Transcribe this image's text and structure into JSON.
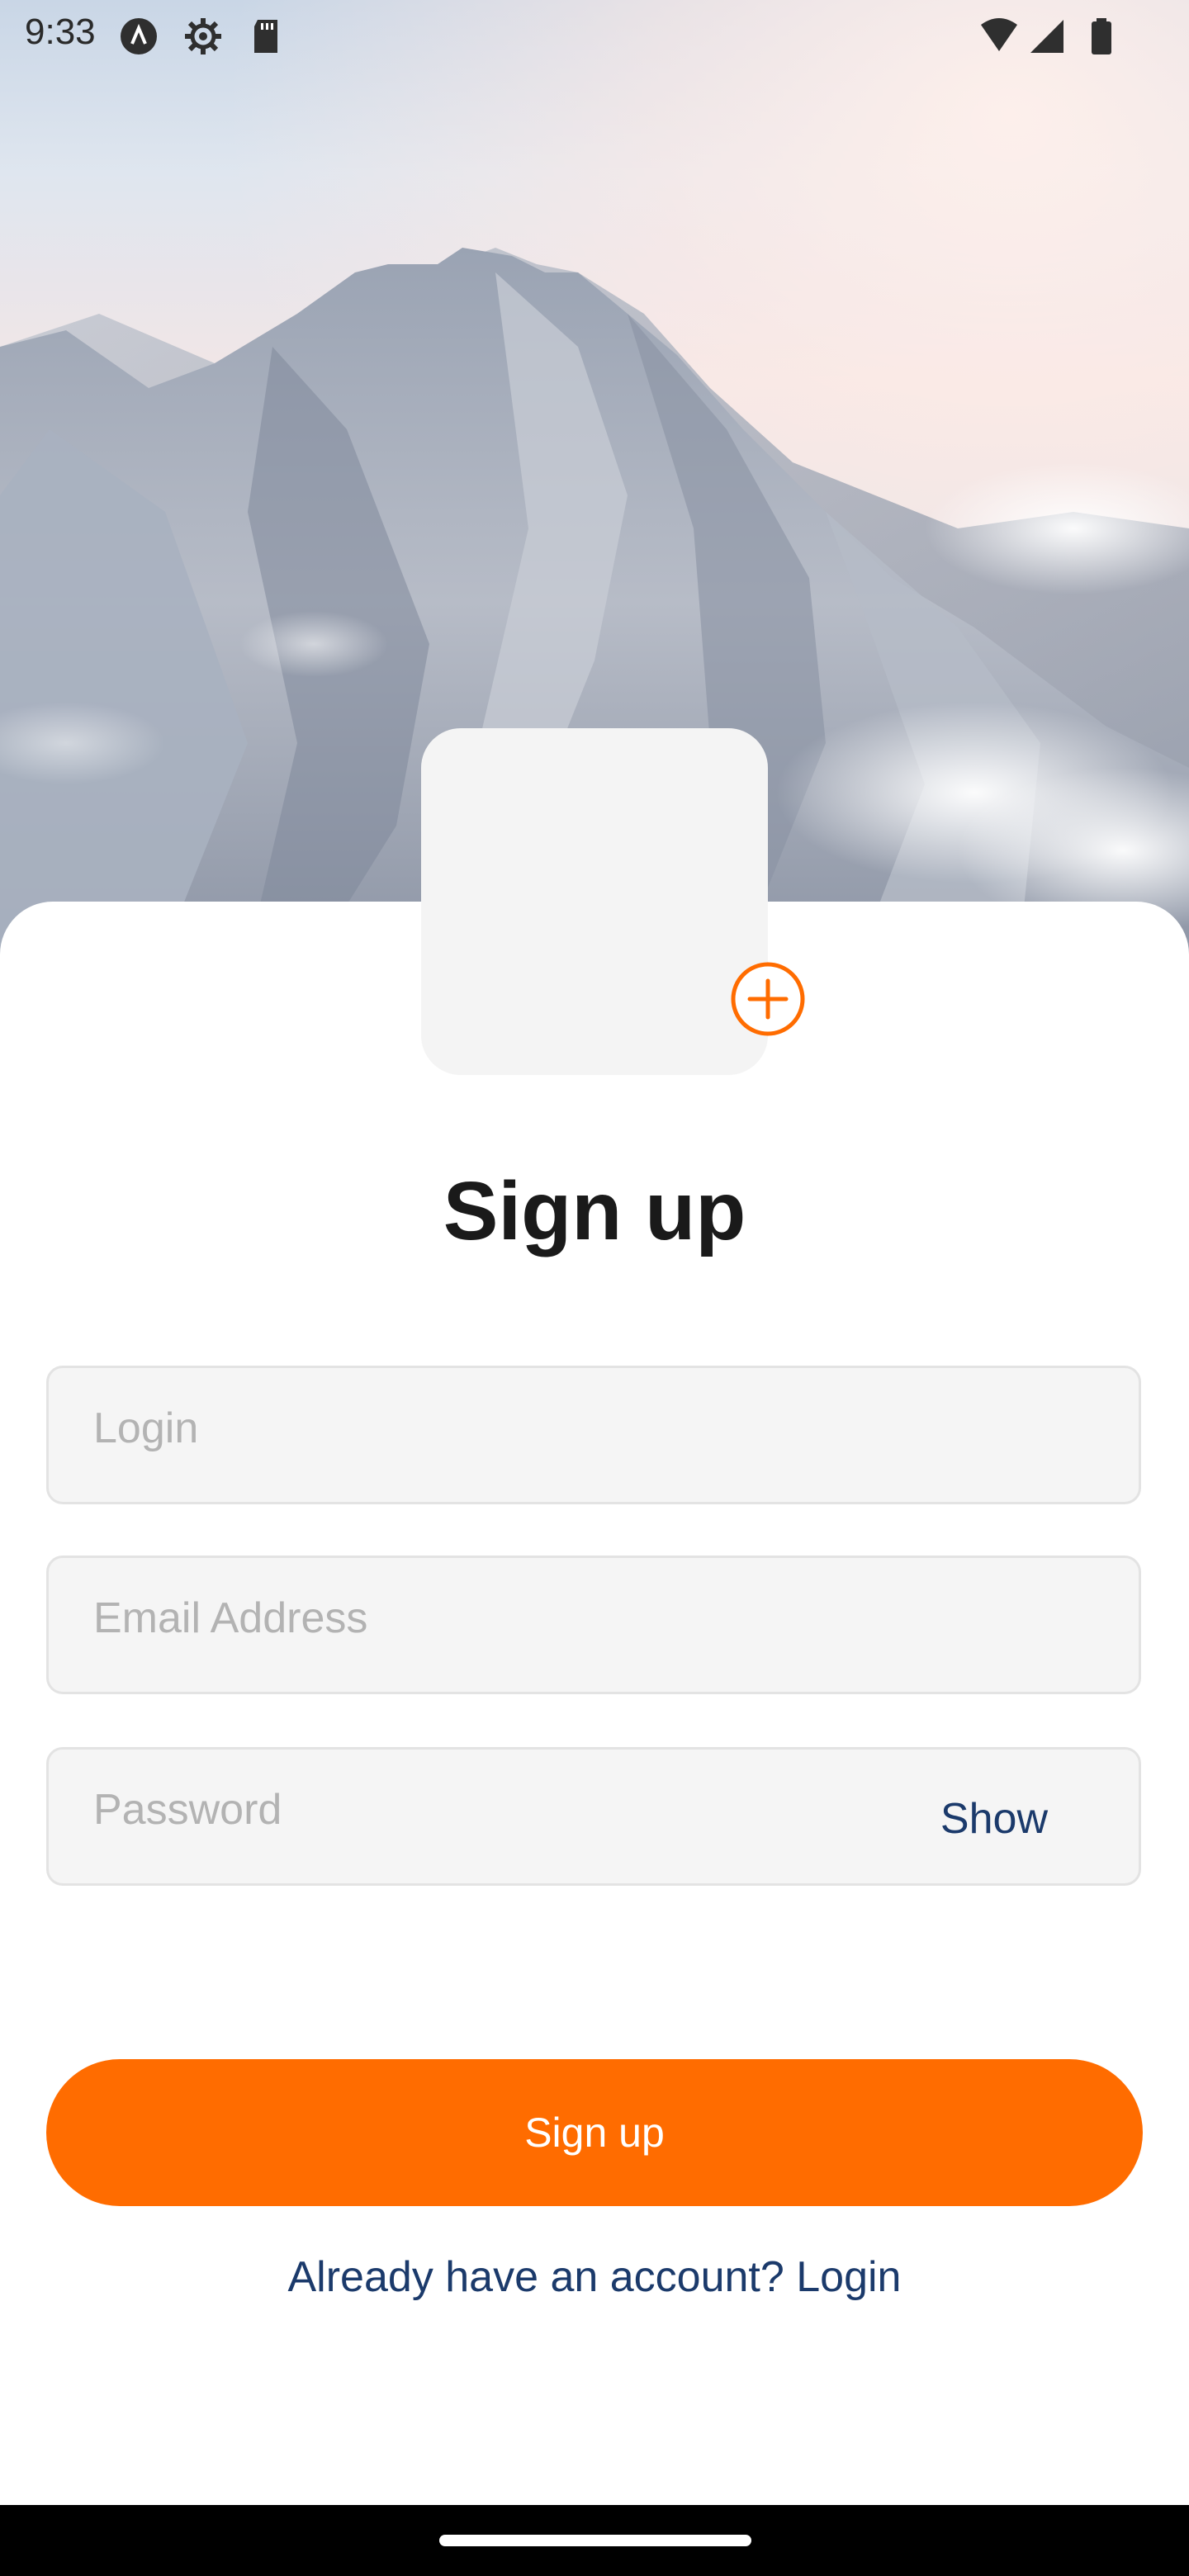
{
  "status_bar": {
    "time": "9:33",
    "icons": [
      "a-icon",
      "settings-gear-icon",
      "sd-card-icon",
      "wifi-icon",
      "cell-signal-icon",
      "battery-icon"
    ]
  },
  "hero": {
    "image": "mountain-background"
  },
  "avatar": {
    "add_icon": "plus-circle-icon"
  },
  "form": {
    "title": "Sign up",
    "login_placeholder": "Login",
    "email_placeholder": "Email Address",
    "password_placeholder": "Password",
    "show_label": "Show",
    "submit_label": "Sign up",
    "login_link": "Already have an account? Login"
  },
  "colors": {
    "accent": "#ff6c00",
    "link": "#1b3a6b",
    "field_bg": "#f5f5f5"
  }
}
